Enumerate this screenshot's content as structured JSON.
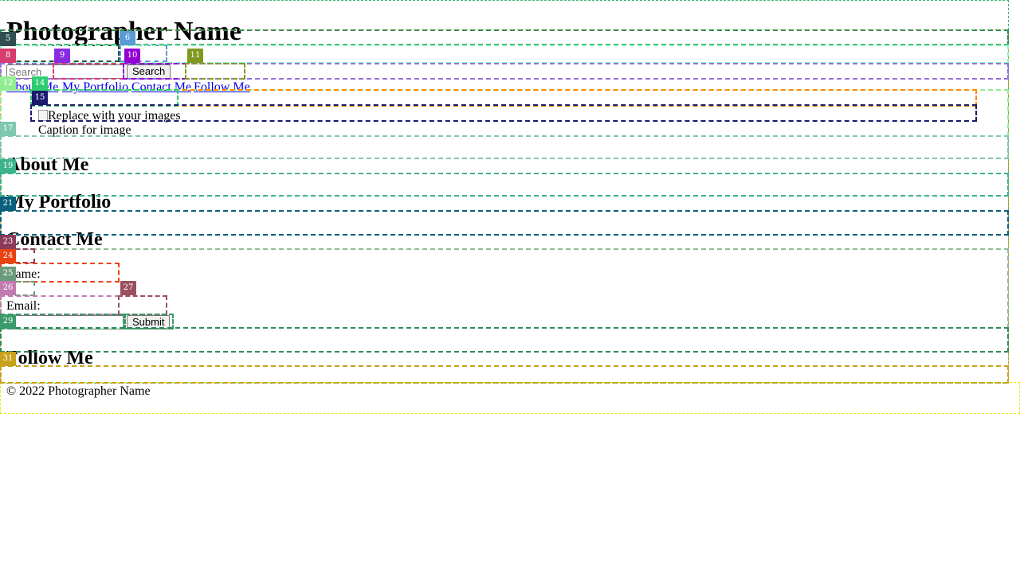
{
  "header": {
    "title": "Photographer Name"
  },
  "search": {
    "placeholder": "Search",
    "button_label": "Search"
  },
  "nav": {
    "items": [
      "About Me",
      "My Portfolio",
      "Contact Me",
      "Follow Me"
    ]
  },
  "slideshow": {
    "image_alt": "Replace with your images",
    "caption": "Caption for image"
  },
  "sections": {
    "about_title": "About Me",
    "portfolio_title": "My Portfolio",
    "contact_title": "Contact Me",
    "follow_title": "Follow Me"
  },
  "contact_form": {
    "name_label": "Name:",
    "email_label": "Email:",
    "submit_label": "Submit"
  },
  "footer": {
    "text": "© 2022 Photographer Name"
  },
  "overlay_tags": [
    {
      "label": "5",
      "color": "#2f4f4f"
    },
    {
      "label": "6",
      "color": "#5b9bd5"
    },
    {
      "label": "8",
      "color": "#d63c6e"
    },
    {
      "label": "9",
      "color": "#8a2be2"
    },
    {
      "label": "10",
      "color": "#9400d3"
    },
    {
      "label": "11",
      "color": "#7f9a1e"
    },
    {
      "label": "12",
      "color": "#90ee90"
    },
    {
      "label": "14",
      "color": "#2ecc71"
    },
    {
      "label": "15",
      "color": "#1a1a6e"
    },
    {
      "label": "17",
      "color": "#7fc7af"
    },
    {
      "label": "19",
      "color": "#3cb38a"
    },
    {
      "label": "21",
      "color": "#0a5f7a"
    },
    {
      "label": "23",
      "color": "#8b3a5a"
    },
    {
      "label": "24",
      "color": "#e8420e"
    },
    {
      "label": "25",
      "color": "#6a9a7a"
    },
    {
      "label": "26",
      "color": "#c27ab0"
    },
    {
      "label": "27",
      "color": "#9a5060"
    },
    {
      "label": "29",
      "color": "#3a9a6a"
    },
    {
      "label": "31",
      "color": "#c7a21a"
    }
  ]
}
